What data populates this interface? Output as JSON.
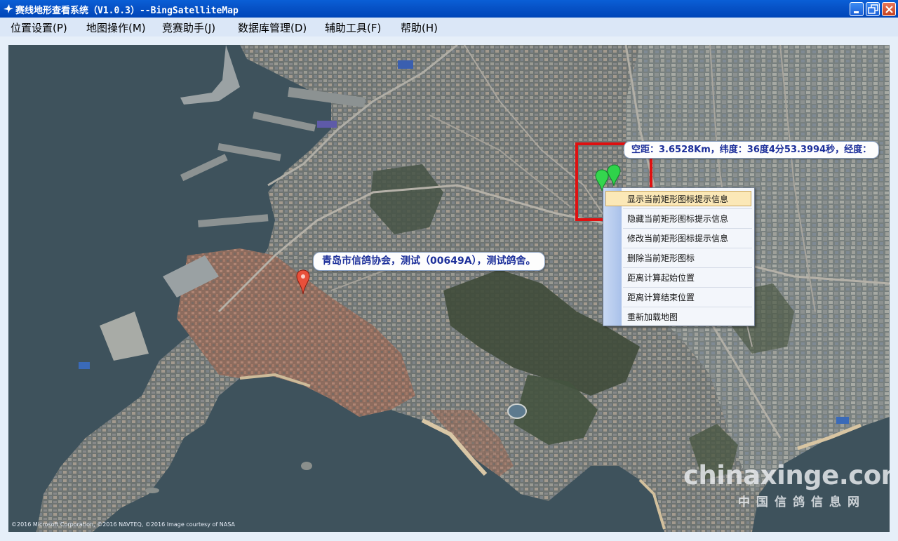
{
  "window": {
    "title": "赛线地形查看系统（V1.0.3）--BingSatelliteMap",
    "title_bar_color": "#0a5fd6",
    "buttons": [
      "minimize-icon",
      "maximize-icon",
      "close-icon"
    ]
  },
  "menubar": {
    "items": [
      {
        "label": "位置设置(P)"
      },
      {
        "label": "地图操作(M)"
      },
      {
        "label": "竞赛助手(J)"
      },
      {
        "label": "数据库管理(D)"
      },
      {
        "label": "辅助工具(F)"
      },
      {
        "label": "帮助(H)"
      }
    ]
  },
  "map": {
    "distance_tooltip": "空距：3.6528Km，纬度：36度4分53.3994秒，经度：",
    "pigeon_tooltip": "青岛市信鸽协会，测试（00649A），测试鸽舍。",
    "copyright": "©2016 Microsoft Corporation, ©2016 NAVTEQ, ©2016 Image courtesy of NASA",
    "markers": [
      {
        "icon": "red-pin-icon",
        "color": "#e8503a"
      },
      {
        "icon": "green-pin-icon",
        "color": "#2fd34a"
      },
      {
        "icon": "green-pin-icon",
        "color": "#2fd34a"
      }
    ],
    "selection_rect_color": "#e01010"
  },
  "context_menu": {
    "items": [
      {
        "label": "显示当前矩形图标提示信息",
        "highlighted": true
      },
      {
        "label": "隐藏当前矩形图标提示信息"
      },
      {
        "label": "修改当前矩形图标提示信息"
      },
      {
        "label": "删除当前矩形图标"
      },
      {
        "label": "距离计算起始位置"
      },
      {
        "label": "距离计算结束位置"
      },
      {
        "label": "重新加载地图"
      }
    ]
  },
  "watermark": {
    "text": "chinaxinge.com",
    "subtext": "中国信鸽信息网"
  }
}
